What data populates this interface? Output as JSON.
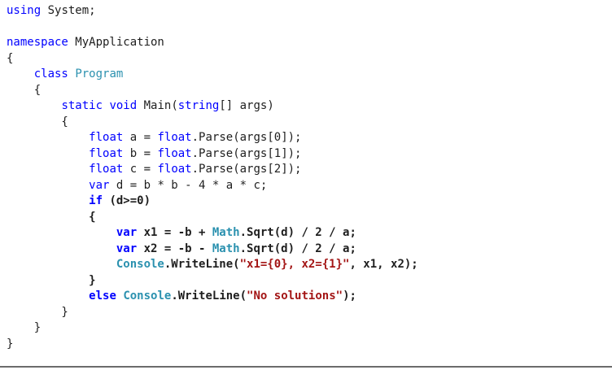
{
  "colors": {
    "keyword": "#0000ff",
    "type": "#2b91af",
    "string": "#a31515",
    "plain": "#1e1e1e",
    "background": "#ffffff"
  },
  "code": {
    "lines": [
      {
        "bold": false,
        "tokens": [
          {
            "t": "kw",
            "v": "using"
          },
          {
            "t": "plain",
            "v": " System;"
          }
        ]
      },
      {
        "bold": false,
        "tokens": []
      },
      {
        "bold": false,
        "tokens": [
          {
            "t": "kw",
            "v": "namespace"
          },
          {
            "t": "plain",
            "v": " MyApplication"
          }
        ]
      },
      {
        "bold": false,
        "tokens": [
          {
            "t": "plain",
            "v": "{"
          }
        ]
      },
      {
        "bold": false,
        "tokens": [
          {
            "t": "plain",
            "v": "    "
          },
          {
            "t": "kw",
            "v": "class"
          },
          {
            "t": "plain",
            "v": " "
          },
          {
            "t": "type",
            "v": "Program"
          }
        ]
      },
      {
        "bold": false,
        "tokens": [
          {
            "t": "plain",
            "v": "    {"
          }
        ]
      },
      {
        "bold": false,
        "tokens": [
          {
            "t": "plain",
            "v": "        "
          },
          {
            "t": "kw",
            "v": "static"
          },
          {
            "t": "plain",
            "v": " "
          },
          {
            "t": "kw",
            "v": "void"
          },
          {
            "t": "plain",
            "v": " Main("
          },
          {
            "t": "kw",
            "v": "string"
          },
          {
            "t": "plain",
            "v": "[] args)"
          }
        ]
      },
      {
        "bold": false,
        "tokens": [
          {
            "t": "plain",
            "v": "        {"
          }
        ]
      },
      {
        "bold": false,
        "tokens": [
          {
            "t": "plain",
            "v": "            "
          },
          {
            "t": "kw",
            "v": "float"
          },
          {
            "t": "plain",
            "v": " a = "
          },
          {
            "t": "kw",
            "v": "float"
          },
          {
            "t": "plain",
            "v": ".Parse(args[0]);"
          }
        ]
      },
      {
        "bold": false,
        "tokens": [
          {
            "t": "plain",
            "v": "            "
          },
          {
            "t": "kw",
            "v": "float"
          },
          {
            "t": "plain",
            "v": " b = "
          },
          {
            "t": "kw",
            "v": "float"
          },
          {
            "t": "plain",
            "v": ".Parse(args[1]);"
          }
        ]
      },
      {
        "bold": false,
        "tokens": [
          {
            "t": "plain",
            "v": "            "
          },
          {
            "t": "kw",
            "v": "float"
          },
          {
            "t": "plain",
            "v": " c = "
          },
          {
            "t": "kw",
            "v": "float"
          },
          {
            "t": "plain",
            "v": ".Parse(args[2]);"
          }
        ]
      },
      {
        "bold": false,
        "tokens": [
          {
            "t": "plain",
            "v": "            "
          },
          {
            "t": "kw",
            "v": "var"
          },
          {
            "t": "plain",
            "v": " d = b * b - 4 * a * c;"
          }
        ]
      },
      {
        "bold": true,
        "tokens": [
          {
            "t": "plain",
            "v": "            "
          },
          {
            "t": "kw",
            "v": "if"
          },
          {
            "t": "plain",
            "v": " (d>=0)"
          }
        ]
      },
      {
        "bold": true,
        "tokens": [
          {
            "t": "plain",
            "v": "            {"
          }
        ]
      },
      {
        "bold": true,
        "tokens": [
          {
            "t": "plain",
            "v": "                "
          },
          {
            "t": "kw",
            "v": "var"
          },
          {
            "t": "plain",
            "v": " x1 = -b + "
          },
          {
            "t": "type",
            "v": "Math"
          },
          {
            "t": "plain",
            "v": ".Sqrt(d) / 2 / a;"
          }
        ]
      },
      {
        "bold": true,
        "tokens": [
          {
            "t": "plain",
            "v": "                "
          },
          {
            "t": "kw",
            "v": "var"
          },
          {
            "t": "plain",
            "v": " x2 = -b - "
          },
          {
            "t": "type",
            "v": "Math"
          },
          {
            "t": "plain",
            "v": ".Sqrt(d) / 2 / a;"
          }
        ]
      },
      {
        "bold": true,
        "tokens": [
          {
            "t": "plain",
            "v": "                "
          },
          {
            "t": "type",
            "v": "Console"
          },
          {
            "t": "plain",
            "v": ".WriteLine("
          },
          {
            "t": "str",
            "v": "\"x1={0}, x2={1}\""
          },
          {
            "t": "plain",
            "v": ", x1, x2);"
          }
        ]
      },
      {
        "bold": true,
        "tokens": [
          {
            "t": "plain",
            "v": "            }"
          }
        ]
      },
      {
        "bold": true,
        "tokens": [
          {
            "t": "plain",
            "v": "            "
          },
          {
            "t": "kw",
            "v": "else"
          },
          {
            "t": "plain",
            "v": " "
          },
          {
            "t": "type",
            "v": "Console"
          },
          {
            "t": "plain",
            "v": ".WriteLine("
          },
          {
            "t": "str",
            "v": "\"No solutions\""
          },
          {
            "t": "plain",
            "v": ");"
          }
        ]
      },
      {
        "bold": false,
        "tokens": [
          {
            "t": "plain",
            "v": "        }"
          }
        ]
      },
      {
        "bold": false,
        "tokens": [
          {
            "t": "plain",
            "v": "    }"
          }
        ]
      },
      {
        "bold": false,
        "tokens": [
          {
            "t": "plain",
            "v": "}"
          }
        ]
      }
    ]
  }
}
